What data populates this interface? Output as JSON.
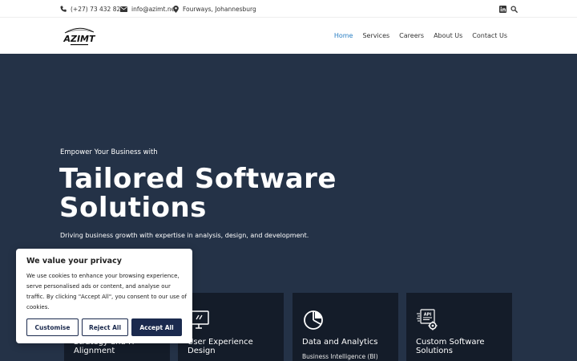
{
  "topbar": {
    "phone": "(+27) 73 432 8202",
    "email": "info@azimt.net",
    "location": "Fourways, Johannesburg"
  },
  "brand": {
    "logo_text": "AZIMT"
  },
  "nav": {
    "items": [
      {
        "label": "Home",
        "active": true
      },
      {
        "label": "Services"
      },
      {
        "label": "Careers"
      },
      {
        "label": "About Us"
      },
      {
        "label": "Contact Us"
      }
    ]
  },
  "hero": {
    "kicker": "Empower Your Business with",
    "title": "Tailored Software Solutions",
    "subtitle": "Driving business growth with expertise in analysis, design, and development."
  },
  "cards": [
    {
      "title": "Strategy and IT Alignment",
      "subtitle": "",
      "icon": "strategy-icon"
    },
    {
      "title": "User Experience Design",
      "subtitle": "",
      "icon": "monitor-icon"
    },
    {
      "title": "Data and Analytics",
      "subtitle": "Business Intelligence (BI)",
      "icon": "pie-chart-icon"
    },
    {
      "title": "Custom Software Solutions",
      "subtitle": "",
      "icon": "api-gear-icon",
      "icon_text": "API"
    }
  ],
  "cookie": {
    "title": "We value your privacy",
    "text": "We use cookies to enhance your browsing experience, serve personalised ads or content, and analyse our traffic. By clicking \"Accept All\", you consent to our use of cookies.",
    "customise": "Customise",
    "reject": "Reject All",
    "accept": "Accept All"
  },
  "colors": {
    "hero_bg": "#243247",
    "card_bg": "#141c29",
    "nav_active": "#2a7fc4",
    "button_primary": "#1b2a4e"
  }
}
